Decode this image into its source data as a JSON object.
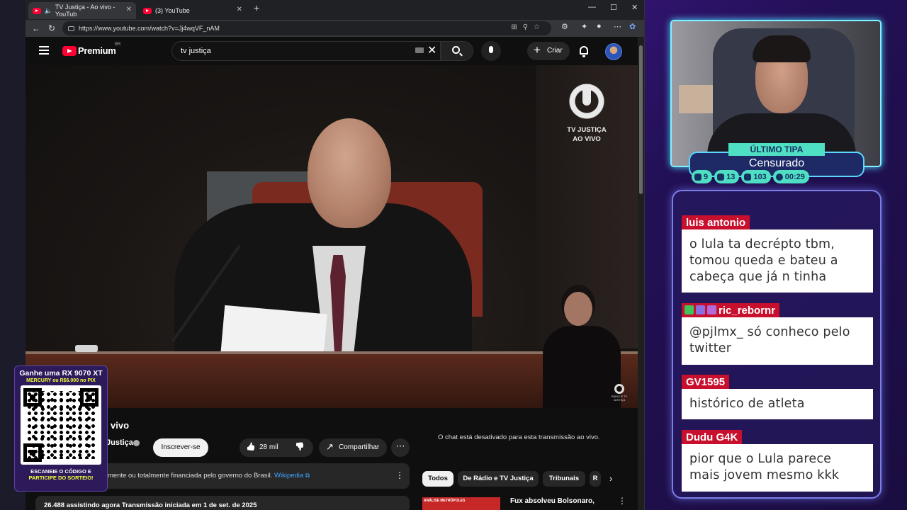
{
  "browser": {
    "tabs": [
      {
        "title": "TV Justiça - Ao vivo - YouTub",
        "active": true
      },
      {
        "title": "(3) YouTube",
        "active": false
      }
    ],
    "url": "https://www.youtube.com/watch?v=Jj4wqVF_nAM"
  },
  "youtube": {
    "brand": "Premium",
    "country": "BR",
    "search_value": "tv justiça",
    "create_label": "Criar",
    "overlay_logo_line1": "TV JUSTIÇA",
    "overlay_logo_line2": "AO VIVO",
    "overlay_small_logo": "RÁDIO E TV JUSTIÇA",
    "video_title": "vivo",
    "channel_name": "Justiça",
    "subscribe_label": "Inscrever-se",
    "likes": "28 mil",
    "share_label": "Compartilhar",
    "info_text": "mente ou totalmente financiada pelo governo do Brasil.",
    "info_link": "Wikipedia",
    "description": "26.488 assistindo agora  Transmissão iniciada em 1 de set. de 2025",
    "chat_disabled": "O chat está desativado para esta transmissão ao vivo.",
    "chips": [
      "Todos",
      "De Rádio e TV Justiça",
      "Tribunais",
      "R"
    ],
    "rec_title": "Fux absolveu Bolsonaro,",
    "rec_thumb_text": "ANÁLISE   METRÓPOLES"
  },
  "promo": {
    "line1": "Ganhe uma RX 9070 XT",
    "line2": "MERCURY ou R$6.000 no PIX",
    "line3": "ESCANEIE O CÓDIGO E",
    "line4": "PARTICIPE DO SORTEIO!"
  },
  "stream": {
    "label": "ÚLTIMO TIPA",
    "name": "Censurado",
    "stats": [
      {
        "icon": "chat-icon",
        "value": "9"
      },
      {
        "icon": "youtube-icon",
        "value": "13"
      },
      {
        "icon": "kick-icon",
        "value": "103"
      },
      {
        "icon": "whatsapp-icon",
        "value": "00:29"
      }
    ]
  },
  "chat": [
    {
      "user": "luis antonio",
      "text": "o lula ta decrépto tbm, tomou queda e bateu a cabeça que já n tinha"
    },
    {
      "user": "ric_rebornr",
      "text": "@pjlmx_ só conheco pelo twitter"
    },
    {
      "user": "GV1595",
      "text": "histórico de atleta"
    },
    {
      "user": "Dudu G4K",
      "text": "pior que o Lula parece mais jovem mesmo kkk"
    }
  ],
  "colors": {
    "youtube_red": "#ff0033",
    "accent_teal": "#4fe0c4",
    "chat_user_red": "#c8102e"
  }
}
